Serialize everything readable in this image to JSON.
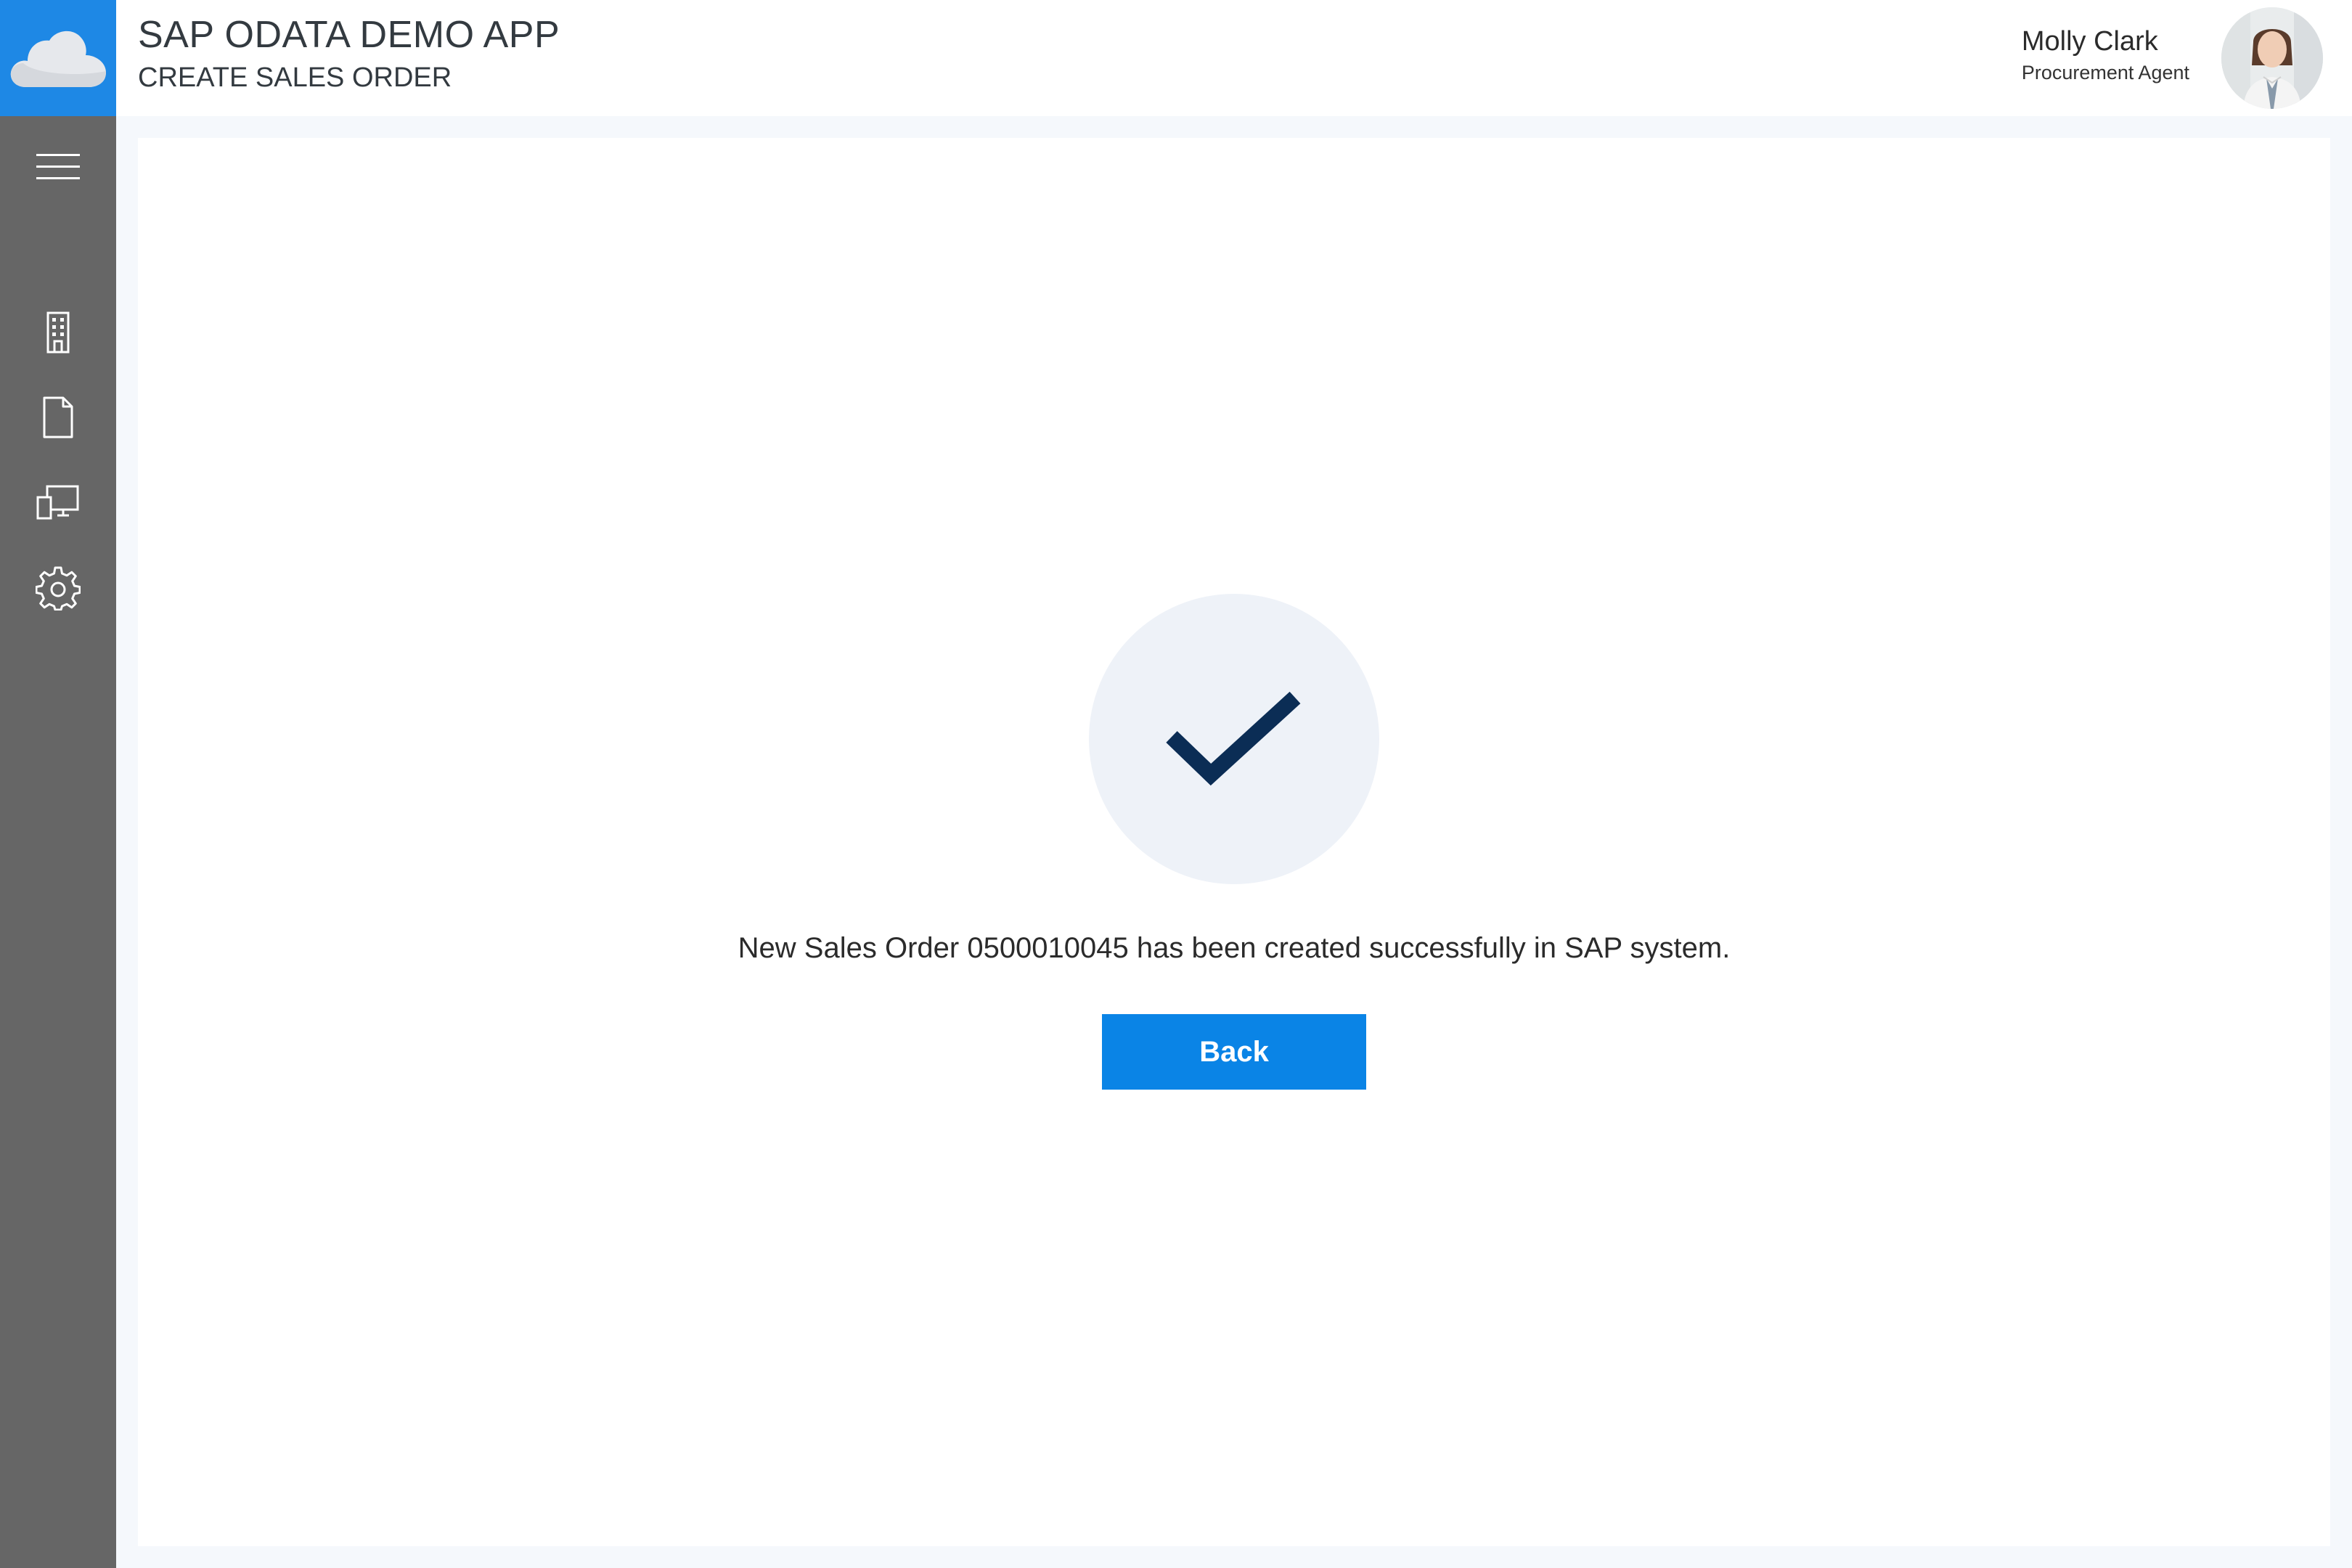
{
  "header": {
    "app_title": "SAP ODATA DEMO APP",
    "page_subtitle": "CREATE SALES ORDER",
    "logo_icon": "cloud-icon"
  },
  "user": {
    "name": "Molly Clark",
    "role": "Procurement Agent"
  },
  "sidebar": {
    "items": [
      {
        "icon": "menu-icon"
      },
      {
        "icon": "building-icon"
      },
      {
        "icon": "document-icon"
      },
      {
        "icon": "devices-icon"
      },
      {
        "icon": "gear-icon"
      }
    ]
  },
  "main": {
    "status_icon": "checkmark-icon",
    "message": "New Sales Order 0500010045 has been created successfully in SAP system.",
    "back_label": "Back"
  },
  "colors": {
    "accent": "#0a84e6",
    "logo_tile": "#1e88e5",
    "sidebar": "#666666",
    "check": "#0b2d55",
    "check_circle": "#eef2f8"
  }
}
